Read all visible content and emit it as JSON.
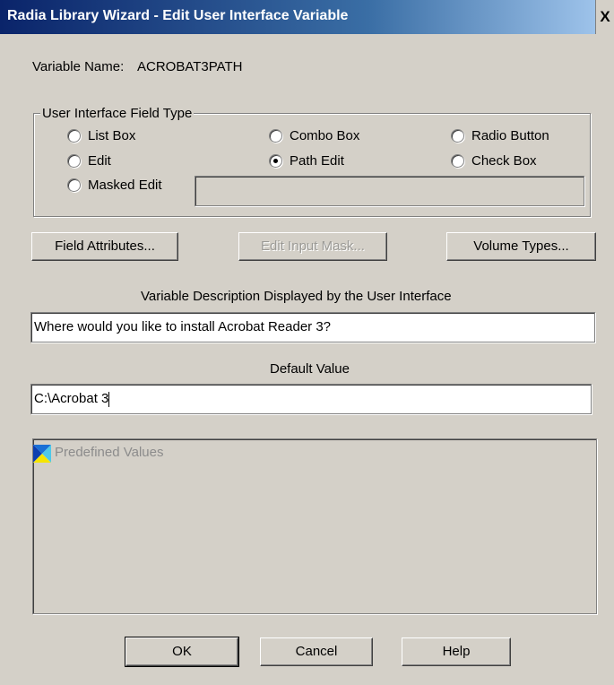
{
  "window": {
    "title": "Radia Library Wizard - Edit User Interface Variable",
    "close_glyph": "X"
  },
  "variable_name": {
    "label": "Variable Name:",
    "value": "ACROBAT3PATH"
  },
  "field_type": {
    "legend": "User Interface Field Type",
    "options": [
      {
        "label": "List Box",
        "checked": false
      },
      {
        "label": "Combo Box",
        "checked": false
      },
      {
        "label": "Radio Button",
        "checked": false
      },
      {
        "label": "Edit",
        "checked": false
      },
      {
        "label": "Path Edit",
        "checked": true
      },
      {
        "label": "Check Box",
        "checked": false
      },
      {
        "label": "Masked Edit",
        "checked": false
      }
    ],
    "mask_value": ""
  },
  "buttons": {
    "field_attributes": "Field Attributes...",
    "edit_input_mask": "Edit Input Mask...",
    "volume_types": "Volume Types...",
    "ok": "OK",
    "cancel": "Cancel",
    "help": "Help"
  },
  "description": {
    "label": "Variable Description Displayed by the User Interface",
    "value": "Where would you like to install Acrobat Reader 3?"
  },
  "default_value": {
    "label": "Default Value",
    "value": "C:\\Acrobat 3"
  },
  "predefined": {
    "label": "Predefined Values",
    "icon": "predefined-values-icon"
  }
}
